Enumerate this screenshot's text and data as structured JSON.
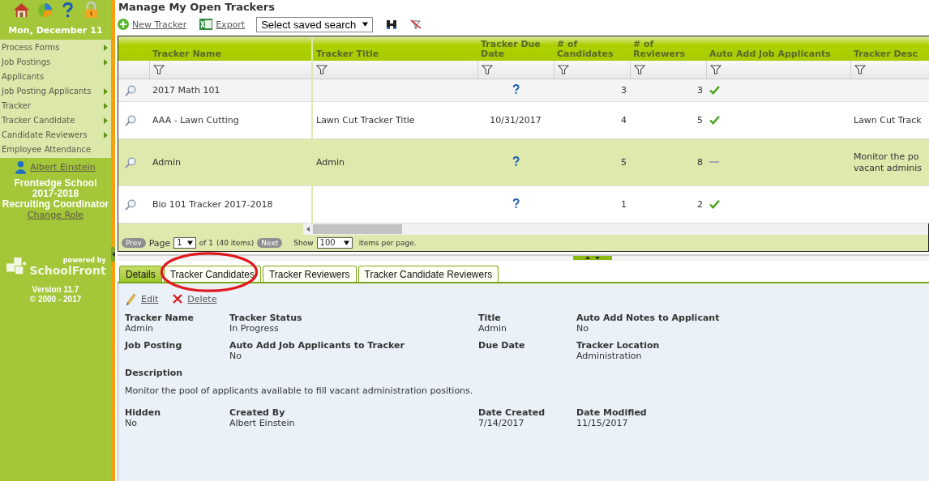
{
  "sidebar": {
    "date": "Mon, December 11",
    "menu": [
      {
        "label": "Process Forms",
        "has_submenu": true
      },
      {
        "label": "Job Postings",
        "has_submenu": true
      },
      {
        "label": "Applicants",
        "has_submenu": false
      },
      {
        "label": "Job Posting Applicants",
        "has_submenu": true
      },
      {
        "label": "Tracker",
        "has_submenu": true
      },
      {
        "label": "Tracker Candidate",
        "has_submenu": true
      },
      {
        "label": "Candidate Reviewers",
        "has_submenu": true
      },
      {
        "label": "Employee Attendance",
        "has_submenu": false
      }
    ],
    "user": "Albert Einstein",
    "school": "Frontedge School",
    "year": "2017-2018",
    "role": "Recruiting Coordinator",
    "change_role": "Change Role",
    "powered_by": "powered by",
    "brand": "SchoolFront",
    "version": "Version 11.7",
    "copyright": "© 2000 - 2017"
  },
  "page_title": "Manage My Open Trackers",
  "toolbar": {
    "new": "New Tracker",
    "export": "Export",
    "saved_search": "Select saved search"
  },
  "table": {
    "columns": [
      "Tracker Name",
      "Tracker Title",
      "Tracker Due Date",
      "# of Candidates",
      "# of Reviewers",
      "Auto Add Job Applicants",
      "Tracker Desc"
    ],
    "rows": [
      {
        "name": "2017 Math 101",
        "title": "",
        "due_date": "",
        "candidates": "3",
        "reviewers": "3",
        "auto_add": true,
        "description": "",
        "selected": false
      },
      {
        "name": "AAA - Lawn Cutting",
        "title": "Lawn Cut Tracker Title",
        "due_date": "10/31/2017",
        "candidates": "4",
        "reviewers": "5",
        "auto_add": true,
        "description": "Lawn Cut Track",
        "selected": false
      },
      {
        "name": "Admin",
        "title": "Admin",
        "due_date": "",
        "candidates": "5",
        "reviewers": "8",
        "auto_add": false,
        "description": "Monitor the po vacant adminis",
        "selected": true
      },
      {
        "name": "Bio 101 Tracker 2017-2018",
        "title": "",
        "due_date": "",
        "candidates": "1",
        "reviewers": "2",
        "auto_add": true,
        "description": "",
        "selected": false
      }
    ]
  },
  "pager": {
    "prev": "Prev",
    "page_label": "Page",
    "page": "1",
    "of": "of 1",
    "items": "(40 items)",
    "next": "Next",
    "show": "Show",
    "per_page": "100",
    "per_page_suffix": "items per page."
  },
  "tabs": [
    {
      "label": "Details",
      "selected": true
    },
    {
      "label": "Tracker Candidates",
      "selected": false
    },
    {
      "label": "Tracker Reviewers",
      "selected": false
    },
    {
      "label": "Tracker Candidate Reviewers",
      "selected": false
    }
  ],
  "details": {
    "edit": "Edit",
    "delete": "Delete",
    "rows": [
      [
        {
          "label": "Tracker Name",
          "value": "Admin"
        },
        {
          "label": "Tracker Status",
          "value": "In Progress"
        },
        {
          "label": "Title",
          "value": "Admin"
        },
        {
          "label": "Auto Add Notes to Applicant",
          "value": "No"
        }
      ],
      [
        {
          "label": "Job Posting"
        },
        {
          "label": "Auto Add Job Applicants to Tracker",
          "value": "No"
        },
        {
          "label": "Due Date"
        },
        {
          "label": "Tracker Location",
          "value": "Administration"
        }
      ]
    ],
    "description_label": "Description",
    "description": "Monitor the pool of applicants available to fill vacant administration positions.",
    "footer_rows": [
      [
        {
          "label": "Hidden",
          "value": "No"
        },
        {
          "label": "Created By",
          "value": "Albert Einstein"
        },
        {
          "label": "Date Created",
          "value": "7/14/2017"
        },
        {
          "label": "Date Modified",
          "value": "11/15/2017"
        }
      ]
    ]
  }
}
